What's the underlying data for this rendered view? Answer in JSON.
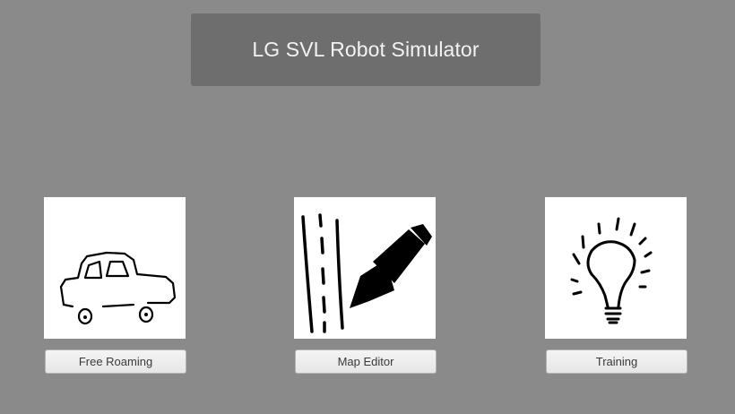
{
  "window": {
    "title": "LG SVL Robot Simulator"
  },
  "modes": [
    {
      "label": "Free Roaming",
      "icon": "car-icon"
    },
    {
      "label": "Map Editor",
      "icon": "road-pencil-icon"
    },
    {
      "label": "Training",
      "icon": "lightbulb-icon"
    }
  ],
  "colors": {
    "background": "#8a8a8a",
    "title_panel": "#6e6e6e",
    "title_text": "#f2f2f2",
    "button_bg": "#eeeeee",
    "thumbnail_bg": "#ffffff"
  }
}
